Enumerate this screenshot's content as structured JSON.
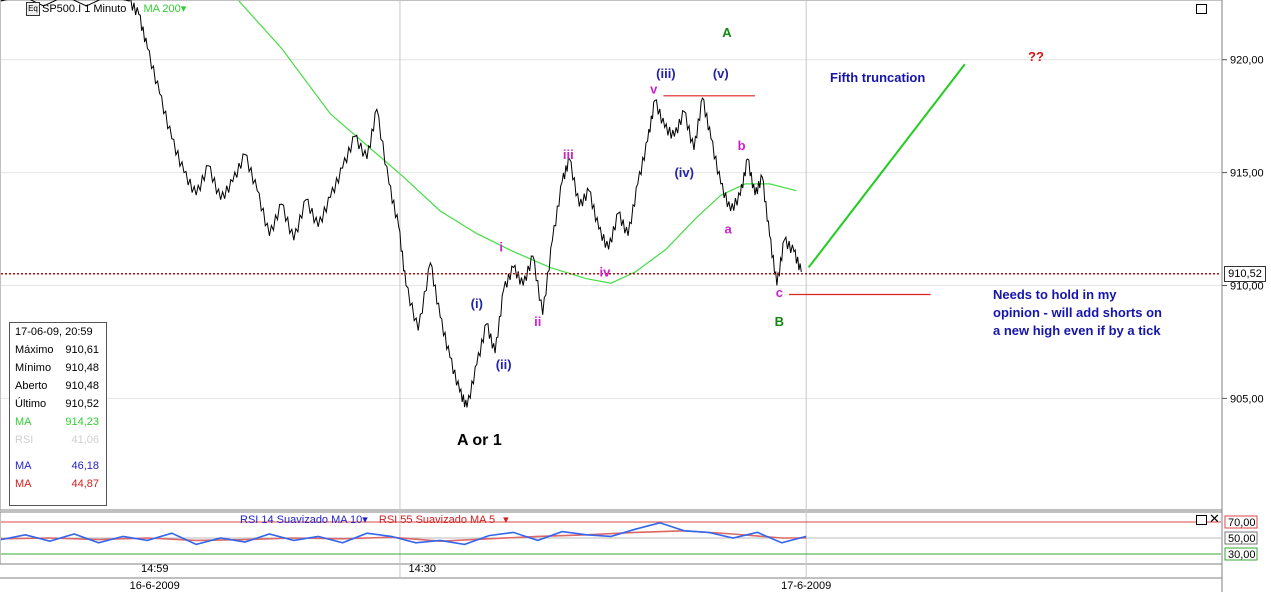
{
  "header": {
    "symbol": "SP500.I 1 Minuto",
    "badge": "Eq",
    "ma_label": "MA 200"
  },
  "info_panel": {
    "date": "17-06-09, 20:59",
    "rows": [
      {
        "label": "Máximo",
        "value": "910,61",
        "color": "#000000"
      },
      {
        "label": "Mínimo",
        "value": "910,48",
        "color": "#000000"
      },
      {
        "label": "Aberto",
        "value": "910,48",
        "color": "#000000"
      },
      {
        "label": "Último",
        "value": "910,52",
        "color": "#000000"
      },
      {
        "label": "MA",
        "value": "914,23",
        "color": "#33cc33"
      },
      {
        "label": "RSI",
        "value": "41,06",
        "color": "#d0d0d0"
      },
      {
        "label": "MA",
        "value": "46,18",
        "color": "#2222cc"
      },
      {
        "label": "MA",
        "value": "44,87",
        "color": "#cc2222"
      }
    ]
  },
  "rsi_legend": {
    "rsi14": "RSI 14 Suavizado MA 10",
    "rsi55": "RSI 55 Suavizado MA 5"
  },
  "current_price": "910,52",
  "annotations": {
    "fifth_truncation": "Fifth truncation",
    "question": "??",
    "a_or_1": "A or 1",
    "note_line1": "Needs to hold in my",
    "note_line2": "opinion - will add shorts on",
    "note_line3": "a new high even if by a tick",
    "wave_labels": [
      {
        "text": "A",
        "color": "#118811",
        "price": 921.0,
        "t": 0.595
      },
      {
        "text": "(v)",
        "color": "#2222aa",
        "price": 919.2,
        "t": 0.59
      },
      {
        "text": "(iii)",
        "color": "#2222aa",
        "price": 919.2,
        "t": 0.545
      },
      {
        "text": "v",
        "color": "#cc22cc",
        "price": 918.5,
        "t": 0.535
      },
      {
        "text": "(iv)",
        "color": "#2222aa",
        "price": 914.8,
        "t": 0.56
      },
      {
        "text": "b",
        "color": "#cc22cc",
        "price": 916.0,
        "t": 0.607
      },
      {
        "text": "a",
        "color": "#cc22cc",
        "price": 912.3,
        "t": 0.596
      },
      {
        "text": "iii",
        "color": "#cc22cc",
        "price": 915.6,
        "t": 0.465
      },
      {
        "text": "i",
        "color": "#cc22cc",
        "price": 911.5,
        "t": 0.41
      },
      {
        "text": "iv",
        "color": "#cc22cc",
        "price": 910.4,
        "t": 0.495
      },
      {
        "text": "ii",
        "color": "#cc22cc",
        "price": 908.2,
        "t": 0.44
      },
      {
        "text": "(i)",
        "color": "#2222aa",
        "price": 909.0,
        "t": 0.39
      },
      {
        "text": "(ii)",
        "color": "#2222aa",
        "price": 906.3,
        "t": 0.412
      },
      {
        "text": "c",
        "color": "#cc22cc",
        "price": 909.5,
        "t": 0.638
      },
      {
        "text": "B",
        "color": "#118811",
        "price": 908.2,
        "t": 0.638
      }
    ]
  },
  "chart_data": {
    "type": "line",
    "title": "SP500.I 1 Minuto",
    "y_ticks": [
      "920,00",
      "915,00",
      "910,00",
      "905,00"
    ],
    "y_tick_values": [
      920,
      915,
      910,
      905
    ],
    "ylim": [
      900.1,
      922.6
    ],
    "x_ticks": [
      {
        "label": "14:59",
        "t": 0.126
      },
      {
        "label": "14:30",
        "t": 0.334
      },
      {
        "label": "16-6-2009",
        "t": 0.126
      },
      {
        "label": "17-6-2009",
        "t": 0.66
      }
    ],
    "x_separators": [
      0.327,
      0.66
    ],
    "price_path": [
      [
        0.0,
        922.6
      ],
      [
        0.105,
        922.6
      ],
      [
        0.113,
        922.0
      ],
      [
        0.12,
        920.5
      ],
      [
        0.13,
        918.5
      ],
      [
        0.14,
        916.5
      ],
      [
        0.15,
        915.0
      ],
      [
        0.16,
        914.0
      ],
      [
        0.17,
        915.3
      ],
      [
        0.18,
        913.8
      ],
      [
        0.19,
        914.6
      ],
      [
        0.2,
        915.8
      ],
      [
        0.21,
        914.2
      ],
      [
        0.22,
        912.2
      ],
      [
        0.23,
        913.6
      ],
      [
        0.24,
        912.0
      ],
      [
        0.25,
        913.8
      ],
      [
        0.26,
        912.6
      ],
      [
        0.27,
        913.9
      ],
      [
        0.28,
        915.2
      ],
      [
        0.29,
        916.6
      ],
      [
        0.3,
        915.6
      ],
      [
        0.308,
        917.8
      ],
      [
        0.318,
        914.5
      ],
      [
        0.326,
        912.6
      ],
      [
        0.332,
        910.0
      ],
      [
        0.342,
        908.0
      ],
      [
        0.352,
        911.0
      ],
      [
        0.36,
        908.6
      ],
      [
        0.368,
        906.8
      ],
      [
        0.376,
        905.3
      ],
      [
        0.382,
        904.6
      ],
      [
        0.39,
        906.5
      ],
      [
        0.398,
        908.3
      ],
      [
        0.405,
        907.0
      ],
      [
        0.412,
        909.8
      ],
      [
        0.42,
        910.8
      ],
      [
        0.428,
        910.0
      ],
      [
        0.436,
        911.3
      ],
      [
        0.444,
        908.7
      ],
      [
        0.452,
        912.0
      ],
      [
        0.46,
        914.6
      ],
      [
        0.466,
        915.6
      ],
      [
        0.474,
        913.5
      ],
      [
        0.482,
        914.2
      ],
      [
        0.49,
        912.5
      ],
      [
        0.498,
        911.6
      ],
      [
        0.506,
        913.2
      ],
      [
        0.514,
        912.2
      ],
      [
        0.522,
        914.5
      ],
      [
        0.53,
        916.4
      ],
      [
        0.536,
        918.2
      ],
      [
        0.544,
        917.0
      ],
      [
        0.552,
        916.6
      ],
      [
        0.56,
        917.7
      ],
      [
        0.568,
        916.0
      ],
      [
        0.575,
        918.3
      ],
      [
        0.582,
        916.5
      ],
      [
        0.59,
        914.5
      ],
      [
        0.598,
        913.3
      ],
      [
        0.606,
        914.0
      ],
      [
        0.612,
        915.6
      ],
      [
        0.618,
        914.0
      ],
      [
        0.624,
        914.8
      ],
      [
        0.63,
        912.2
      ],
      [
        0.636,
        910.0
      ],
      [
        0.642,
        912.0
      ],
      [
        0.65,
        911.5
      ],
      [
        0.656,
        910.6
      ]
    ],
    "ma200_path": [
      [
        0.195,
        922.6
      ],
      [
        0.23,
        920.5
      ],
      [
        0.27,
        917.6
      ],
      [
        0.3,
        916.2
      ],
      [
        0.33,
        914.8
      ],
      [
        0.36,
        913.3
      ],
      [
        0.39,
        912.3
      ],
      [
        0.42,
        911.5
      ],
      [
        0.45,
        910.8
      ],
      [
        0.48,
        910.3
      ],
      [
        0.5,
        910.1
      ],
      [
        0.52,
        910.6
      ],
      [
        0.545,
        911.6
      ],
      [
        0.57,
        913.0
      ],
      [
        0.59,
        914.0
      ],
      [
        0.61,
        914.5
      ],
      [
        0.63,
        914.5
      ],
      [
        0.652,
        914.2
      ]
    ],
    "hlines": [
      {
        "price": 918.4,
        "t0": 0.543,
        "t1": 0.618,
        "color": "#dd2222"
      },
      {
        "price": 909.6,
        "t0": 0.646,
        "t1": 0.762,
        "color": "#dd2222"
      }
    ],
    "current_price_level": 910.52,
    "projection": {
      "from": [
        0.662,
        910.8
      ],
      "to": [
        0.79,
        919.8
      ],
      "color": "#22cc22"
    },
    "rsi": {
      "upper_label": "70,00",
      "mid_label": "50,00",
      "lower_label": "30,00",
      "upper": 70,
      "mid": 50,
      "lower": 30,
      "ylim": [
        20,
        80
      ],
      "rsi14": [
        [
          0.0,
          48
        ],
        [
          0.02,
          54
        ],
        [
          0.04,
          46
        ],
        [
          0.06,
          55
        ],
        [
          0.08,
          44
        ],
        [
          0.1,
          52
        ],
        [
          0.12,
          47
        ],
        [
          0.14,
          56
        ],
        [
          0.16,
          42
        ],
        [
          0.18,
          50
        ],
        [
          0.2,
          45
        ],
        [
          0.22,
          55
        ],
        [
          0.24,
          47
        ],
        [
          0.26,
          52
        ],
        [
          0.28,
          44
        ],
        [
          0.3,
          56
        ],
        [
          0.32,
          52
        ],
        [
          0.34,
          44
        ],
        [
          0.36,
          47
        ],
        [
          0.38,
          42
        ],
        [
          0.4,
          53
        ],
        [
          0.42,
          57
        ],
        [
          0.44,
          47
        ],
        [
          0.46,
          58
        ],
        [
          0.48,
          54
        ],
        [
          0.5,
          52
        ],
        [
          0.52,
          61
        ],
        [
          0.54,
          69
        ],
        [
          0.56,
          59
        ],
        [
          0.58,
          57
        ],
        [
          0.6,
          50
        ],
        [
          0.62,
          57
        ],
        [
          0.64,
          44
        ],
        [
          0.66,
          52
        ]
      ],
      "rsi55": [
        [
          0.0,
          49
        ],
        [
          0.04,
          50
        ],
        [
          0.08,
          48
        ],
        [
          0.12,
          50
        ],
        [
          0.16,
          47
        ],
        [
          0.2,
          48
        ],
        [
          0.24,
          50
        ],
        [
          0.28,
          49
        ],
        [
          0.32,
          51
        ],
        [
          0.36,
          46
        ],
        [
          0.4,
          49
        ],
        [
          0.44,
          52
        ],
        [
          0.48,
          54
        ],
        [
          0.52,
          57
        ],
        [
          0.56,
          59
        ],
        [
          0.6,
          55
        ],
        [
          0.64,
          50
        ],
        [
          0.66,
          50
        ]
      ]
    }
  }
}
